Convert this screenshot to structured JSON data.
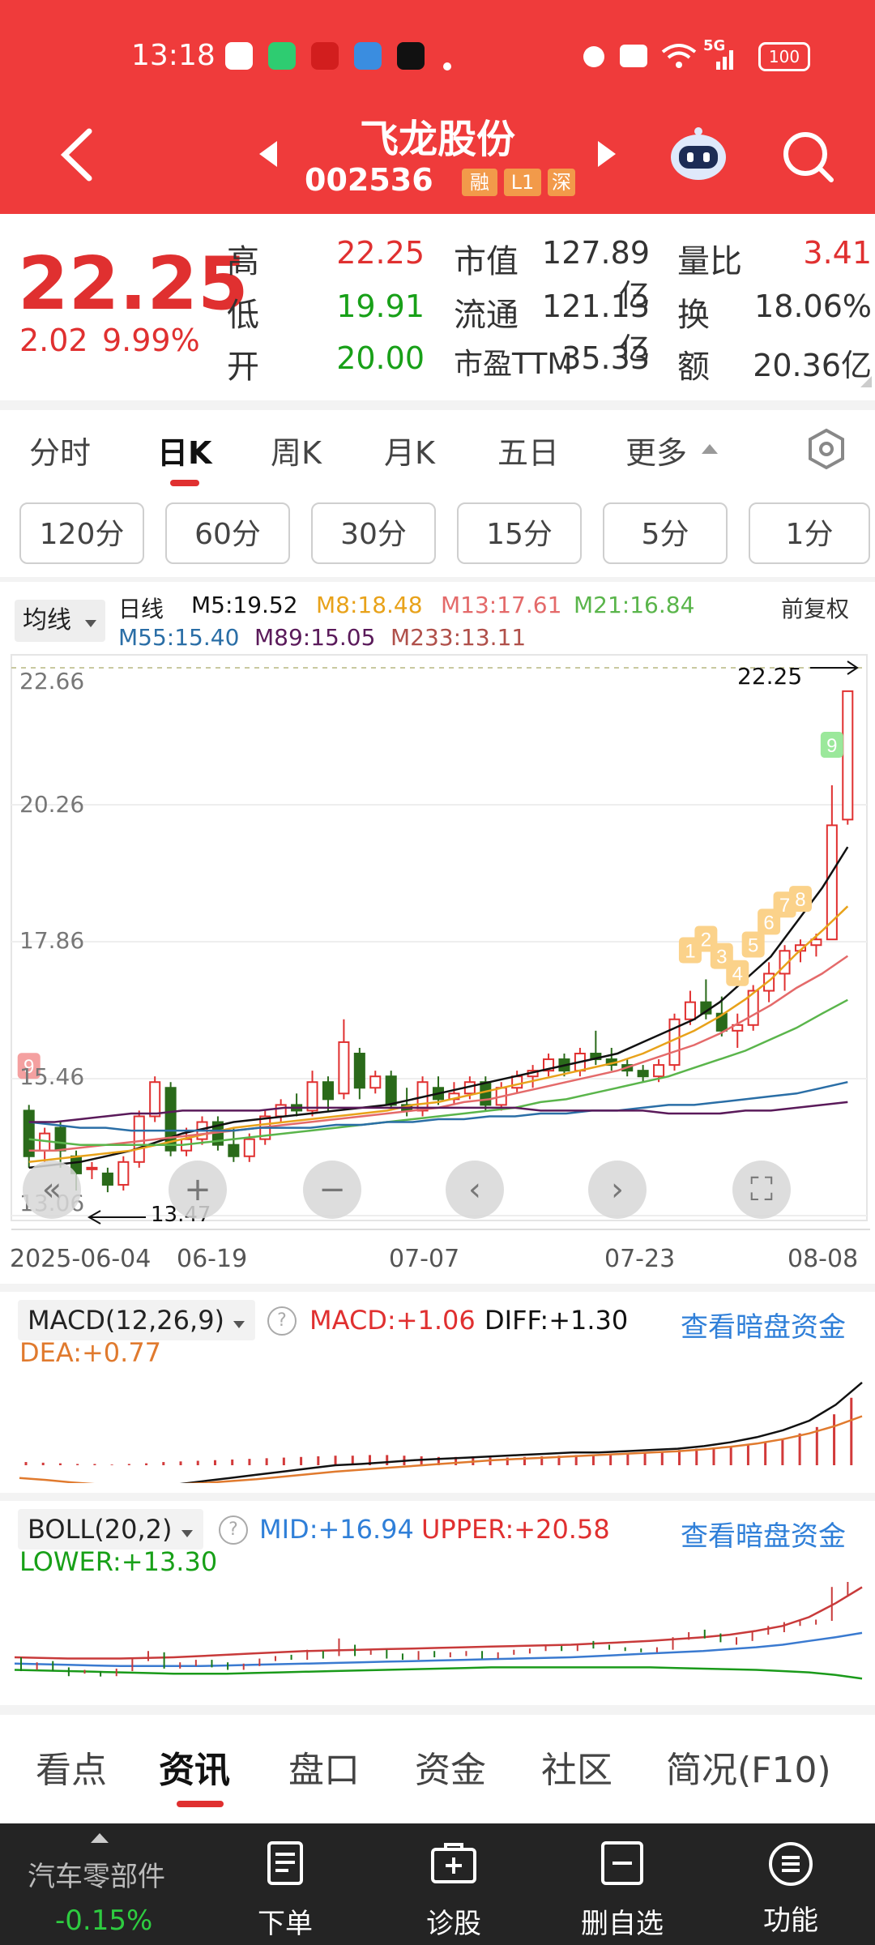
{
  "status_bar": {
    "time": "13:18",
    "battery": "100",
    "signal": "5G"
  },
  "header": {
    "stock_name": "飞龙股份",
    "stock_code": "002536",
    "tags": [
      "融",
      "L1",
      "深"
    ]
  },
  "quote": {
    "price": "22.25",
    "change": "2.02",
    "change_pct": "9.99%",
    "rows": [
      {
        "l1": "高",
        "v1": "22.25",
        "l2": "市值",
        "v2": "127.89亿",
        "l3": "量比",
        "v3": "3.41"
      },
      {
        "l1": "低",
        "v1": "19.91",
        "l2": "流通",
        "v2": "121.13亿",
        "l3": "换",
        "v3": "18.06%"
      },
      {
        "l1": "开",
        "v1": "20.00",
        "l2": "市盈TTM",
        "v2": "35.33",
        "l3": "额",
        "v3": "20.36亿"
      }
    ]
  },
  "tabs": [
    "分时",
    "日K",
    "周K",
    "月K",
    "五日",
    "更多"
  ],
  "periods": [
    "120分",
    "60分",
    "30分",
    "15分",
    "5分",
    "1分"
  ],
  "legend": {
    "ma_button": "均线",
    "line_type": "日线",
    "adjust": "前复权",
    "m5": "M5:19.52",
    "m8": "M8:18.48",
    "m13": "M13:17.61",
    "m21": "M21:16.84",
    "m55": "M55:15.40",
    "m89": "M89:15.05",
    "m233": "M233:13.11"
  },
  "colors": {
    "up": "#e03030",
    "down": "#2a6a1a",
    "header_bg": "#ef3b3b",
    "accent_blue": "#2f7fd8"
  },
  "chart_data": [
    {
      "type": "candlestick",
      "title": "日线",
      "y_ticks": [
        "22.66",
        "20.26",
        "17.86",
        "15.46",
        "13.06"
      ],
      "ylim": [
        13.06,
        22.66
      ],
      "x_ticks": [
        "2025-06-04",
        "06-19",
        "07-07",
        "07-23",
        "08-08"
      ],
      "annotations": {
        "high_label": "22.25",
        "low_label": "13.47"
      },
      "nine_turn_labels": [
        "9",
        "1",
        "2",
        "3",
        "4",
        "5",
        "6",
        "7",
        "8",
        "9"
      ],
      "candles": [
        [
          14.9,
          14.1,
          15.0,
          13.9
        ],
        [
          14.2,
          14.5,
          14.6,
          14.0
        ],
        [
          14.6,
          14.2,
          14.7,
          13.9
        ],
        [
          14.1,
          13.8,
          14.2,
          13.5
        ],
        [
          13.9,
          13.9,
          14.0,
          13.7
        ],
        [
          13.8,
          13.6,
          13.9,
          13.47
        ],
        [
          13.6,
          14.0,
          14.1,
          13.5
        ],
        [
          14.0,
          14.8,
          14.9,
          13.9
        ],
        [
          14.8,
          15.4,
          15.5,
          14.7
        ],
        [
          15.3,
          14.2,
          15.4,
          14.1
        ],
        [
          14.2,
          14.4,
          14.6,
          14.1
        ],
        [
          14.4,
          14.7,
          14.8,
          14.3
        ],
        [
          14.7,
          14.3,
          14.8,
          14.2
        ],
        [
          14.3,
          14.1,
          14.6,
          14.0
        ],
        [
          14.1,
          14.4,
          14.5,
          14.0
        ],
        [
          14.4,
          14.8,
          14.9,
          14.3
        ],
        [
          14.8,
          15.0,
          15.1,
          14.7
        ],
        [
          15.0,
          14.9,
          15.2,
          14.8
        ],
        [
          14.9,
          15.4,
          15.6,
          14.8
        ],
        [
          15.4,
          15.1,
          15.5,
          14.9
        ],
        [
          15.2,
          16.1,
          16.5,
          15.1
        ],
        [
          15.9,
          15.3,
          16.0,
          15.1
        ],
        [
          15.3,
          15.5,
          15.6,
          15.2
        ],
        [
          15.5,
          15.0,
          15.6,
          14.9
        ],
        [
          15.0,
          14.9,
          15.3,
          14.8
        ],
        [
          14.9,
          15.4,
          15.5,
          14.8
        ],
        [
          15.3,
          15.1,
          15.5,
          15.0
        ],
        [
          15.1,
          15.2,
          15.4,
          15.0
        ],
        [
          15.2,
          15.4,
          15.5,
          15.1
        ],
        [
          15.4,
          15.0,
          15.5,
          14.9
        ],
        [
          15.0,
          15.3,
          15.4,
          14.9
        ],
        [
          15.3,
          15.5,
          15.6,
          15.2
        ],
        [
          15.5,
          15.6,
          15.7,
          15.3
        ],
        [
          15.6,
          15.8,
          15.9,
          15.5
        ],
        [
          15.8,
          15.6,
          15.9,
          15.5
        ],
        [
          15.6,
          15.9,
          16.0,
          15.5
        ],
        [
          15.9,
          15.8,
          16.3,
          15.7
        ],
        [
          15.8,
          15.7,
          16.0,
          15.6
        ],
        [
          15.7,
          15.6,
          15.8,
          15.5
        ],
        [
          15.6,
          15.5,
          15.7,
          15.4
        ],
        [
          15.5,
          15.7,
          15.8,
          15.4
        ],
        [
          15.7,
          16.5,
          16.6,
          15.6
        ],
        [
          16.5,
          16.8,
          17.0,
          16.4
        ],
        [
          16.8,
          16.6,
          17.2,
          16.5
        ],
        [
          16.6,
          16.3,
          16.9,
          16.2
        ],
        [
          16.3,
          16.4,
          16.6,
          16.0
        ],
        [
          16.4,
          17.0,
          17.1,
          16.3
        ],
        [
          17.0,
          17.3,
          17.5,
          16.8
        ],
        [
          17.3,
          17.7,
          17.8,
          17.0
        ],
        [
          17.7,
          17.8,
          17.9,
          17.5
        ],
        [
          17.8,
          17.9,
          18.0,
          17.6
        ],
        [
          17.9,
          19.9,
          20.6,
          17.9
        ],
        [
          20.0,
          22.25,
          22.25,
          19.91
        ]
      ],
      "ma_lines": {
        "m5": [
          13.9,
          13.95,
          14.0,
          14.1,
          14.2,
          14.35,
          14.5,
          14.6,
          14.7,
          14.75,
          14.8,
          14.85,
          14.9,
          14.95,
          15.0,
          15.1,
          15.2,
          15.3,
          15.4,
          15.5,
          15.6,
          15.7,
          15.8,
          15.9,
          16.1,
          16.3,
          16.5,
          16.8,
          17.2,
          17.6,
          18.2,
          18.8,
          19.52
        ],
        "m8": [
          14.0,
          14.05,
          14.1,
          14.15,
          14.2,
          14.3,
          14.4,
          14.5,
          14.6,
          14.65,
          14.7,
          14.75,
          14.8,
          14.85,
          14.9,
          15.0,
          15.05,
          15.15,
          15.25,
          15.35,
          15.45,
          15.55,
          15.65,
          15.75,
          15.9,
          16.1,
          16.3,
          16.55,
          16.85,
          17.2,
          17.65,
          18.05,
          18.48
        ],
        "m13": [
          14.2,
          14.2,
          14.25,
          14.3,
          14.35,
          14.4,
          14.45,
          14.5,
          14.55,
          14.6,
          14.65,
          14.7,
          14.75,
          14.8,
          14.85,
          14.9,
          14.95,
          15.05,
          15.1,
          15.2,
          15.3,
          15.4,
          15.5,
          15.6,
          15.75,
          15.9,
          16.05,
          16.25,
          16.5,
          16.75,
          17.05,
          17.3,
          17.61
        ],
        "m21": [
          14.4,
          14.35,
          14.3,
          14.3,
          14.3,
          14.3,
          14.3,
          14.35,
          14.4,
          14.45,
          14.5,
          14.55,
          14.6,
          14.65,
          14.7,
          14.75,
          14.8,
          14.85,
          14.9,
          14.95,
          15.05,
          15.1,
          15.2,
          15.3,
          15.4,
          15.5,
          15.65,
          15.8,
          15.95,
          16.15,
          16.35,
          16.6,
          16.84
        ],
        "m55": [
          14.7,
          14.65,
          14.6,
          14.6,
          14.55,
          14.55,
          14.55,
          14.55,
          14.55,
          14.6,
          14.6,
          14.6,
          14.65,
          14.65,
          14.7,
          14.7,
          14.75,
          14.75,
          14.8,
          14.8,
          14.85,
          14.85,
          14.9,
          14.9,
          14.95,
          15.0,
          15.0,
          15.05,
          15.1,
          15.15,
          15.2,
          15.3,
          15.4
        ],
        "m89": [
          14.7,
          14.7,
          14.75,
          14.8,
          14.85,
          14.85,
          14.9,
          14.9,
          14.9,
          14.9,
          14.95,
          14.95,
          14.95,
          14.95,
          14.95,
          14.95,
          14.95,
          14.95,
          14.95,
          14.95,
          14.9,
          14.9,
          14.9,
          14.9,
          14.9,
          14.85,
          14.85,
          14.85,
          14.9,
          14.9,
          14.95,
          15.0,
          15.05
        ]
      }
    },
    {
      "type": "bar",
      "title": "MACD(12,26,9)",
      "labels": {
        "macd": "MACD:+1.06",
        "diff": "DIFF:+1.30",
        "dea": "DEA:+0.77",
        "link": "查看暗盘资金"
      },
      "histogram": [
        0.05,
        0.04,
        0.03,
        0.02,
        0.02,
        0.01,
        0.02,
        0.03,
        0.05,
        0.06,
        0.07,
        0.08,
        0.09,
        0.1,
        0.11,
        0.12,
        0.13,
        0.14,
        0.15,
        0.15,
        0.16,
        0.16,
        0.15,
        0.14,
        0.13,
        0.13,
        0.12,
        0.12,
        0.12,
        0.13,
        0.14,
        0.15,
        0.16,
        0.17,
        0.18,
        0.19,
        0.2,
        0.22,
        0.24,
        0.26,
        0.28,
        0.3,
        0.33,
        0.37,
        0.42,
        0.5,
        0.6,
        0.8,
        1.06
      ],
      "diff": [
        -0.3,
        -0.35,
        -0.4,
        -0.42,
        -0.4,
        -0.35,
        -0.3,
        -0.25,
        -0.2,
        -0.15,
        -0.1,
        -0.05,
        0.0,
        0.02,
        0.05,
        0.08,
        0.1,
        0.12,
        0.14,
        0.16,
        0.18,
        0.2,
        0.2,
        0.22,
        0.24,
        0.26,
        0.3,
        0.36,
        0.44,
        0.55,
        0.7,
        0.95,
        1.3
      ],
      "dea": [
        -0.2,
        -0.23,
        -0.27,
        -0.3,
        -0.32,
        -0.32,
        -0.3,
        -0.28,
        -0.25,
        -0.22,
        -0.18,
        -0.14,
        -0.1,
        -0.07,
        -0.04,
        -0.01,
        0.02,
        0.05,
        0.08,
        0.1,
        0.12,
        0.14,
        0.16,
        0.18,
        0.2,
        0.22,
        0.25,
        0.29,
        0.34,
        0.41,
        0.5,
        0.62,
        0.77
      ]
    },
    {
      "type": "line",
      "title": "BOLL(20,2)",
      "labels": {
        "mid": "MID:+16.94",
        "upper": "UPPER:+20.58",
        "lower": "LOWER:+13.30",
        "link": "查看暗盘资金"
      },
      "upper": [
        15.0,
        14.95,
        14.9,
        14.9,
        14.9,
        14.95,
        15.0,
        15.1,
        15.2,
        15.3,
        15.4,
        15.5,
        15.55,
        15.6,
        15.65,
        15.7,
        15.75,
        15.8,
        15.85,
        15.9,
        15.95,
        16.0,
        16.1,
        16.2,
        16.3,
        16.45,
        16.6,
        16.8,
        17.1,
        17.5,
        18.2,
        19.3,
        20.58
      ],
      "mid": [
        14.5,
        14.45,
        14.4,
        14.35,
        14.3,
        14.3,
        14.3,
        14.3,
        14.35,
        14.4,
        14.45,
        14.5,
        14.55,
        14.6,
        14.65,
        14.7,
        14.75,
        14.8,
        14.85,
        14.9,
        14.95,
        15.0,
        15.1,
        15.2,
        15.3,
        15.4,
        15.5,
        15.65,
        15.8,
        16.0,
        16.3,
        16.6,
        16.94
      ],
      "lower": [
        14.0,
        13.95,
        13.9,
        13.85,
        13.8,
        13.75,
        13.7,
        13.7,
        13.7,
        13.75,
        13.8,
        13.85,
        13.9,
        13.95,
        14.0,
        14.05,
        14.1,
        14.15,
        14.2,
        14.2,
        14.2,
        14.2,
        14.2,
        14.2,
        14.2,
        14.15,
        14.1,
        14.05,
        14.0,
        13.9,
        13.8,
        13.6,
        13.3
      ]
    }
  ],
  "bottom_tabs": [
    "看点",
    "资讯",
    "盘口",
    "资金",
    "社区",
    "简况(F10)"
  ],
  "bottom_nav": {
    "sector_name": "汽车零部件",
    "sector_change": "-0.15%",
    "items": [
      "下单",
      "诊股",
      "删自选",
      "功能"
    ]
  }
}
